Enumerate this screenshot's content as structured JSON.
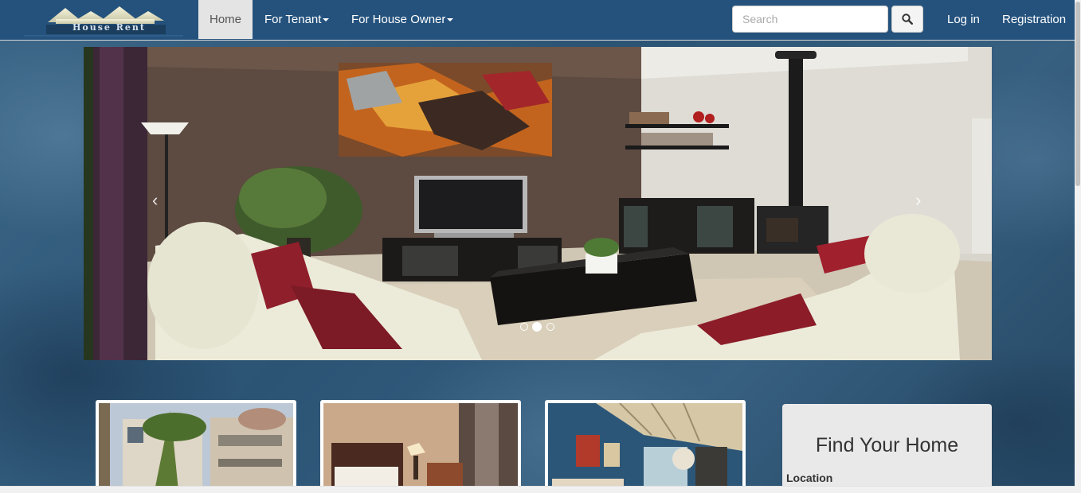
{
  "brand": {
    "logo_text": "House Rent"
  },
  "nav": {
    "home": "Home",
    "tenant": "For Tenant",
    "owner": "For House Owner",
    "login": "Log in",
    "registration": "Registration"
  },
  "search": {
    "placeholder": "Search",
    "button_icon": "search-icon"
  },
  "carousel": {
    "prev": "‹",
    "next": "›",
    "slides_total": 3,
    "active_slide": 2
  },
  "find": {
    "title": "Find Your Home",
    "location_label": "Location"
  },
  "colors": {
    "navbar": "#24527d",
    "background": "#2a4f6e",
    "active_nav": "#e4e4e4"
  }
}
